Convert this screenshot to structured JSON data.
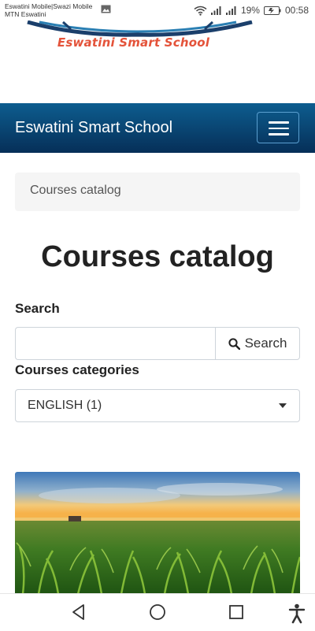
{
  "status_bar": {
    "carrier_line1": "Eswatini Mobile|Swazi Mobile",
    "carrier_line2": "MTN Eswatini",
    "battery": "19%",
    "time": "00:58"
  },
  "logo": {
    "text": "Eswatini Smart School"
  },
  "navbar": {
    "brand": "Eswatini Smart School"
  },
  "breadcrumb": {
    "item": "Courses catalog"
  },
  "page": {
    "title": "Courses catalog"
  },
  "search": {
    "label": "Search",
    "value": "",
    "button_label": "Search"
  },
  "categories": {
    "label": "Courses categories",
    "selected": "ENGLISH (1)"
  },
  "icons": {
    "menu": "hamburger-icon",
    "search": "magnifier-icon",
    "back": "triangle-back-icon",
    "home": "circle-home-icon",
    "recents": "square-recents-icon",
    "accessibility": "person-accessibility-icon"
  },
  "colors": {
    "navbar_top": "#0d5d8f",
    "navbar_bottom": "#062f58",
    "logo_text": "#e4533a"
  }
}
